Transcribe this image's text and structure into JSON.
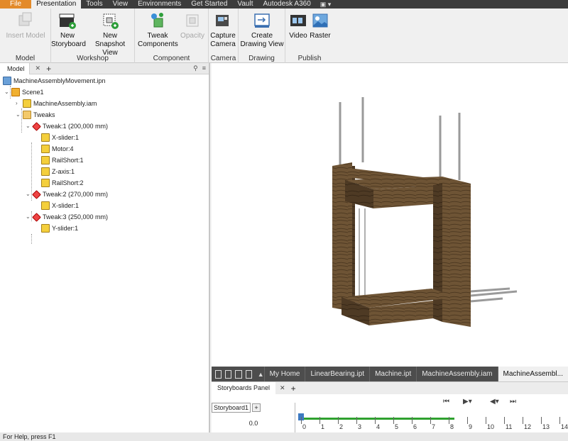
{
  "tabs": [
    "File",
    "Presentation",
    "Tools",
    "View",
    "Environments",
    "Get Started",
    "Vault",
    "Autodesk A360"
  ],
  "ribbon": {
    "model": {
      "title": "Model",
      "insert_model": "Insert Model"
    },
    "workshop": {
      "title": "Workshop",
      "new_storyboard": [
        "New",
        "Storyboard"
      ],
      "new_snapshot": [
        "New",
        "Snapshot View"
      ]
    },
    "component": {
      "title": "Component",
      "tweak": [
        "Tweak",
        "Components"
      ],
      "opacity": "Opacity"
    },
    "camera": {
      "title": "Camera",
      "capture": [
        "Capture",
        "Camera"
      ]
    },
    "drawing": {
      "title": "Drawing",
      "create": [
        "Create",
        "Drawing View"
      ]
    },
    "publish": {
      "title": "Publish",
      "video": "Video",
      "raster": "Raster"
    }
  },
  "browser": {
    "tab": "Model",
    "nodes": [
      {
        "label": "MachineAssemblyMovement.ipn",
        "type": "ipn"
      },
      {
        "label": "Scene1",
        "type": "scene"
      },
      {
        "label": "MachineAssembly.iam",
        "type": "cube"
      },
      {
        "label": "Tweaks",
        "type": "folder"
      },
      {
        "label": "Tweak:1 (200,000 mm)",
        "type": "tweak"
      },
      {
        "label": "X-slider:1",
        "type": "cube"
      },
      {
        "label": "Motor:4",
        "type": "cube"
      },
      {
        "label": "RailShort:1",
        "type": "cube"
      },
      {
        "label": "Z-axis:1",
        "type": "cube"
      },
      {
        "label": "RailShort:2",
        "type": "cube"
      },
      {
        "label": "Tweak:2 (270,000 mm)",
        "type": "tweak"
      },
      {
        "label": "X-slider:1",
        "type": "cube"
      },
      {
        "label": "Tweak:3 (250,000 mm)",
        "type": "tweak"
      },
      {
        "label": "Y-slider:1",
        "type": "cube"
      }
    ]
  },
  "doc_tabs": [
    "My Home",
    "LinearBearing.ipt",
    "Machine.ipt",
    "MachineAssembly.iam",
    "MachineAssembl..."
  ],
  "storyboard": {
    "panel_title": "Storyboards Panel",
    "tab": "Storyboard1",
    "time": "0.0",
    "ticks": [
      "0",
      "1",
      "2",
      "3",
      "4",
      "5",
      "6",
      "7",
      "8",
      "9",
      "10",
      "11",
      "12",
      "13",
      "14"
    ]
  },
  "status": "For Help, press F1"
}
